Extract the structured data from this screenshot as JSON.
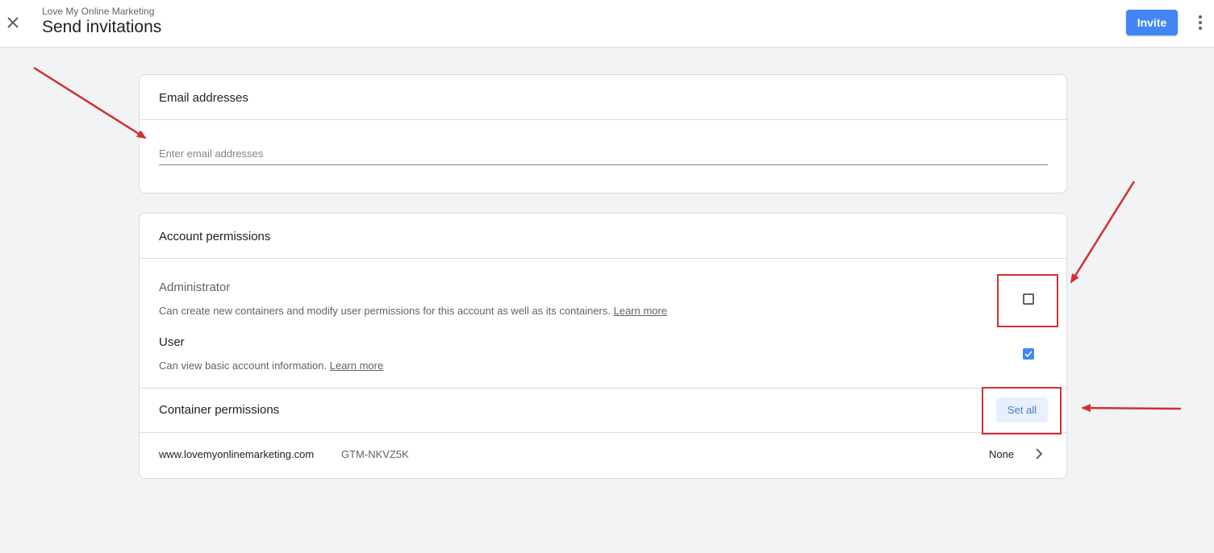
{
  "header": {
    "account_name": "Love My Online Marketing",
    "title": "Send invitations",
    "invite_label": "Invite",
    "close_icon": "close-icon",
    "more_icon": "more-vert-icon"
  },
  "email_card": {
    "title": "Email addresses",
    "input_placeholder": "Enter email addresses",
    "input_value": ""
  },
  "permissions_card": {
    "title": "Account permissions",
    "roles": [
      {
        "name": "Administrator",
        "description": "Can create new containers and modify user permissions for this account as well as its containers.",
        "learn_more": "Learn more",
        "checked": false
      },
      {
        "name": "User",
        "description": "Can view basic account information.",
        "learn_more": "Learn more",
        "checked": true
      }
    ],
    "container_section": {
      "title": "Container permissions",
      "set_all_label": "Set all",
      "containers": [
        {
          "name": "www.lovemyonlinemarketing.com",
          "id": "GTM-NKVZ5K",
          "permission": "None"
        }
      ]
    }
  },
  "colors": {
    "primary": "#4285f4",
    "annotation": "#d32f2f",
    "background": "#f1f3f4"
  }
}
